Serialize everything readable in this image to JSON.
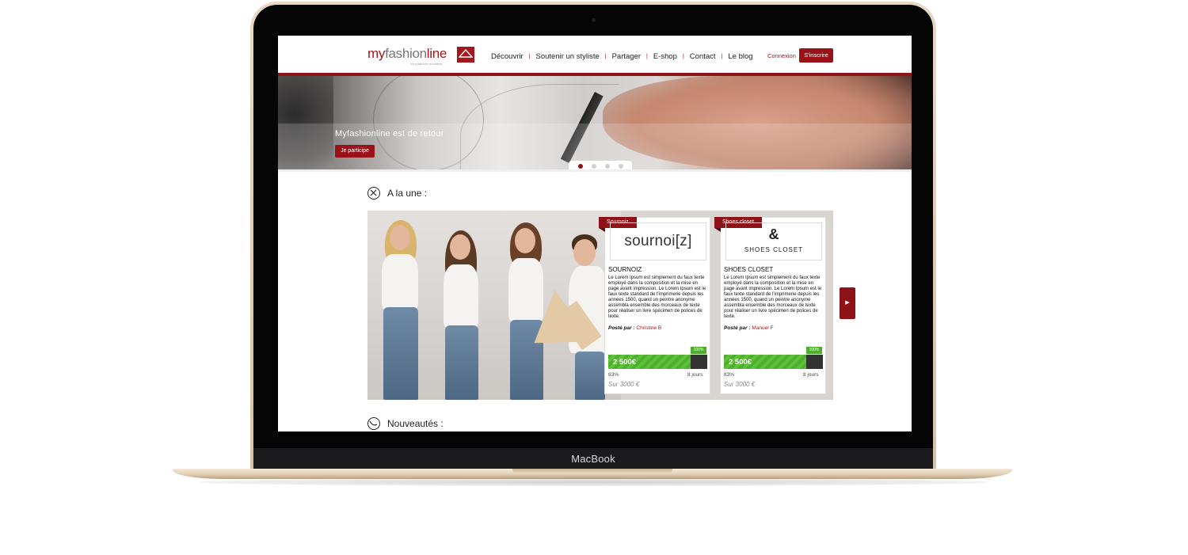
{
  "device": {
    "brand_label": "MacBook"
  },
  "site": {
    "logo": {
      "word_my": "my",
      "word_fashion": "fashion",
      "word_line": "line",
      "tagline": "Your fashion revolution"
    },
    "nav": [
      {
        "label": "Découvrir"
      },
      {
        "label": "Soutenir un styliste"
      },
      {
        "label": "Partager"
      },
      {
        "label": "E-shop"
      },
      {
        "label": "Contact"
      },
      {
        "label": "Le blog"
      }
    ],
    "login_label": "Connexion",
    "signup_label": "S'inscrire"
  },
  "banner": {
    "title": "Myfashionline est de retour",
    "button_label": "Je participe",
    "slides_count": 4,
    "active_slide": 1
  },
  "sections": {
    "featured_title": "A la une :",
    "new_title": "Nouveautés :"
  },
  "cards": [
    {
      "tag": "Sournoiz",
      "logo_text": "sournoi[z]",
      "title": "SOURNOIZ",
      "description": "Le Lorem Ipsum est simplement du faux texte employé dans la composition et la mise en page avant impression. Le Lorem Ipsum est le faux texte standard de l'imprimerie depuis les années 1500, quand un peintre anonyme assembla ensemble des morceaux de texte pour réaliser un livre spécimen de polices de texte.",
      "posted_label": "Posté par :",
      "author": "Christine B",
      "badge": "100%",
      "amount": "2 500€",
      "progress_fraction": 0.83,
      "percent_label": "83%",
      "days_label": "8 jours",
      "goal_label": "Sur 3000 €"
    },
    {
      "tag": "Shoes closet",
      "logo_text": "SHOES CLOSET",
      "title": "SHOES CLOSET",
      "description": "Le Lorem Ipsum est simplement du faux texte employé dans la composition et la mise en page avant impression. Le Lorem Ipsum est le faux texte standard de l'imprimerie depuis les années 1500, quand un peintre anonyme assembla ensemble des morceaux de texte pour réaliser un livre spécimen de polices de texte.",
      "posted_label": "Posté par :",
      "author": "Manuel F",
      "badge": "100%",
      "amount": "2 500€",
      "progress_fraction": 0.83,
      "percent_label": "83%",
      "days_label": "8 jours",
      "goal_label": "Sur 3000 €"
    }
  ],
  "next_label": "▶",
  "colors": {
    "brand_red": "#8e1318",
    "progress_green": "#4fae2f",
    "laptop_gold": "#e2cdb2"
  }
}
